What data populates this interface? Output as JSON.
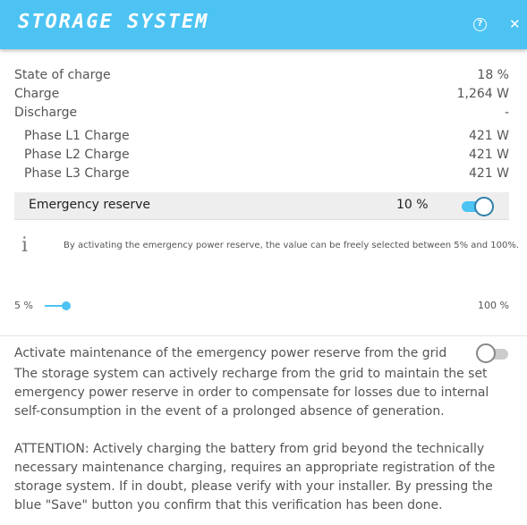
{
  "header": {
    "title": "Storage System",
    "help_icon": "question-circle-icon",
    "help_glyph": "?",
    "close_icon": "close-icon",
    "close_glyph": "✕"
  },
  "summary": {
    "state_of_charge": {
      "label": "State of charge",
      "value": "18 %"
    },
    "charge": {
      "label": "Charge",
      "value": "1,264 W"
    },
    "discharge": {
      "label": "Discharge",
      "value": "-"
    }
  },
  "phases": [
    {
      "label": "Phase L1 Charge",
      "value": "421 W"
    },
    {
      "label": "Phase L2 Charge",
      "value": "421 W"
    },
    {
      "label": "Phase L3 Charge",
      "value": "421 W"
    }
  ],
  "emergency_reserve": {
    "label": "Emergency reserve",
    "value": "10 %",
    "enabled": true
  },
  "info": {
    "icon": "info-icon",
    "glyph": "i",
    "text": "By activating the emergency power reserve, the value can be freely selected between 5% and 100%."
  },
  "slider": {
    "min_label": "5 %",
    "max_label": "100 %",
    "value_percent": 10
  },
  "maintenance": {
    "title": "Activate maintenance of the emergency power reserve from the grid",
    "enabled": false,
    "description": "The storage system can actively recharge from the grid to maintain the set emergency power reserve in order to compensate for losses due to internal self-consumption in the event of a prolonged absence of generation.",
    "attention": "ATTENTION: Actively charging the battery from grid beyond the technically necessary maintenance charging, requires an appropriate registration of the storage system. If in doubt, please verify with your installer. By pressing the blue \"Save\" button you confirm that this verification has been done."
  },
  "colors": {
    "accent": "#4cc3f2",
    "text": "#555555"
  }
}
